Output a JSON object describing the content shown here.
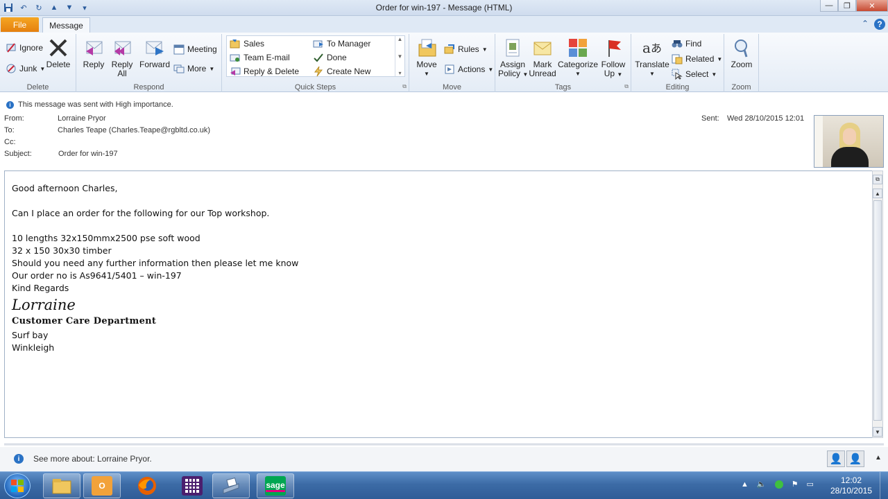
{
  "window": {
    "title": "Order for win-197  -  Message (HTML)",
    "controls": {
      "minimize": "—",
      "maximize": "❐",
      "close": "✕"
    }
  },
  "ribbon_tabs": {
    "file": "File",
    "message": "Message"
  },
  "ribbon": {
    "delete_group": {
      "label": "Delete",
      "ignore": "Ignore",
      "junk": "Junk",
      "delete": "Delete"
    },
    "respond_group": {
      "label": "Respond",
      "reply": "Reply",
      "reply_all_1": "Reply",
      "reply_all_2": "All",
      "forward": "Forward",
      "meeting": "Meeting",
      "more": "More"
    },
    "quick_steps": {
      "label": "Quick Steps",
      "items": [
        "Sales",
        "To Manager",
        "Team E-mail",
        "Done",
        "Reply & Delete",
        "Create New"
      ]
    },
    "move_group": {
      "label": "Move",
      "move": "Move",
      "rules": "Rules",
      "actions": "Actions"
    },
    "tags_group": {
      "label": "Tags",
      "assign_policy_1": "Assign",
      "assign_policy_2": "Policy",
      "mark_unread_1": "Mark",
      "mark_unread_2": "Unread",
      "categorize": "Categorize",
      "follow_up_1": "Follow",
      "follow_up_2": "Up"
    },
    "editing_group": {
      "label": "Editing",
      "translate": "Translate",
      "find": "Find",
      "related": "Related",
      "select": "Select"
    },
    "zoom_group": {
      "label": "Zoom",
      "zoom": "Zoom"
    }
  },
  "header": {
    "importance": "This message was sent with High importance.",
    "from_label": "From:",
    "from": "Lorraine Pryor",
    "to_label": "To:",
    "to": "Charles Teape (Charles.Teape@rgbltd.co.uk)",
    "cc_label": "Cc:",
    "cc": "",
    "subject_label": "Subject:",
    "subject": "Order for win-197",
    "sent_label": "Sent:",
    "sent": "Wed 28/10/2015 12:01"
  },
  "body": {
    "greeting": "Good afternoon Charles,",
    "line1": "Can I place an order for the following for our Top workshop.",
    "line2": "10 lengths 32x150mmx2500 pse soft wood",
    "line3": "32 x 150 30x30 timber",
    "line4": "Should you need any further information then please let me know",
    "line5": "Our order no is As9641/5401 – win-197",
    "line6": "Kind Regards",
    "sig_name": "Lorraine",
    "sig_dept": "Customer Care Department",
    "sig_addr1": "Surf bay",
    "sig_addr2": "Winkleigh"
  },
  "people_pane": {
    "text": "See more about: Lorraine Pryor."
  },
  "taskbar": {
    "sage_label": "sage",
    "clock_time": "12:02",
    "clock_date": "28/10/2015"
  }
}
